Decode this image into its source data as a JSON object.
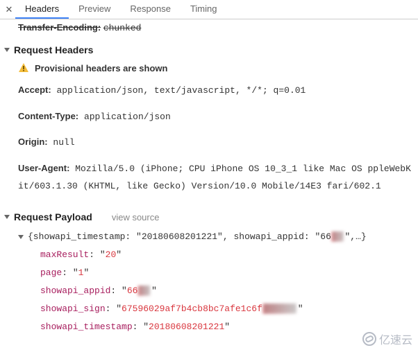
{
  "tabs": {
    "headers": "Headers",
    "preview": "Preview",
    "response": "Response",
    "timing": "Timing"
  },
  "truncated": {
    "key": "Transfer-Encoding:",
    "value": "chunked"
  },
  "requestHeaders": {
    "title": "Request Headers",
    "warning": "Provisional headers are shown",
    "accept": {
      "key": "Accept:",
      "value": "application/json, text/javascript, */*; q=0.01"
    },
    "contentType": {
      "key": "Content-Type:",
      "value": "application/json"
    },
    "origin": {
      "key": "Origin:",
      "value": "null"
    },
    "userAgent": {
      "key": "User-Agent:",
      "value": "Mozilla/5.0 (iPhone; CPU iPhone OS 10_3_1 like Mac OS ppleWebKit/603.1.30 (KHTML, like Gecko) Version/10.0 Mobile/14E3 fari/602.1"
    }
  },
  "requestPayload": {
    "title": "Request Payload",
    "viewSource": "view source",
    "summaryPrefix": "{showapi_timestamp: ",
    "summaryVal1": "\"20180608201221\"",
    "summaryMid": ", showapi_appid: ",
    "summaryVal2": "\"66",
    "summarySuffix": "\",…}",
    "items": {
      "maxResult": {
        "key": "maxResult",
        "value": "20"
      },
      "page": {
        "key": "page",
        "value": "1"
      },
      "showapi_appid": {
        "key": "showapi_appid",
        "value": "66",
        "blurred": "▒▒"
      },
      "showapi_sign": {
        "key": "showapi_sign",
        "value": "67596029af7b4cb8bc7afe1c6f",
        "blurred": "▒▒▒▒▒▒"
      },
      "showapi_timestamp": {
        "key": "showapi_timestamp",
        "value": "20180608201221"
      }
    }
  },
  "watermark": "亿速云"
}
